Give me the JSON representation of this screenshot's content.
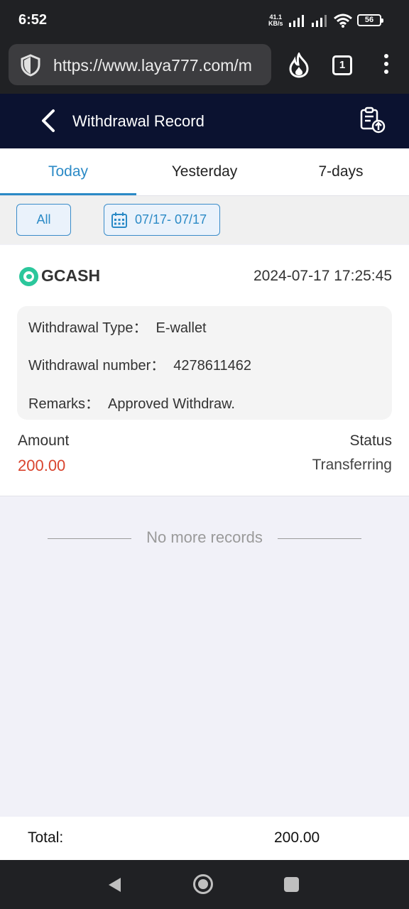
{
  "status_bar": {
    "time": "6:52",
    "speed_value": "41.1",
    "speed_unit": "KB/s",
    "battery": "56"
  },
  "browser": {
    "url": "https://www.laya777.com/m",
    "tab_count": "1"
  },
  "header": {
    "title": "Withdrawal Record"
  },
  "tabs": [
    {
      "label": "Today",
      "active": true
    },
    {
      "label": "Yesterday",
      "active": false
    },
    {
      "label": "7-days",
      "active": false
    }
  ],
  "filters": {
    "all_label": "All",
    "date_range": "07/17- 07/17"
  },
  "record": {
    "channel": "GCASH",
    "time": "2024-07-17 17:25:45",
    "type_label": "Withdrawal Type：",
    "type_value": "E-wallet",
    "number_label": "Withdrawal number：",
    "number_value": "4278611462",
    "remarks_label": "Remarks：",
    "remarks_value": "Approved Withdraw.",
    "amount_label": "Amount",
    "amount_value": "200.00",
    "status_label": "Status",
    "status_value": "Transferring"
  },
  "no_more_text": "No more records",
  "footer": {
    "total_label": "Total:",
    "total_value": "200.00"
  },
  "colors": {
    "accent": "#2b8ac6",
    "header_bg": "#0b1230",
    "amount": "#d9442e"
  }
}
